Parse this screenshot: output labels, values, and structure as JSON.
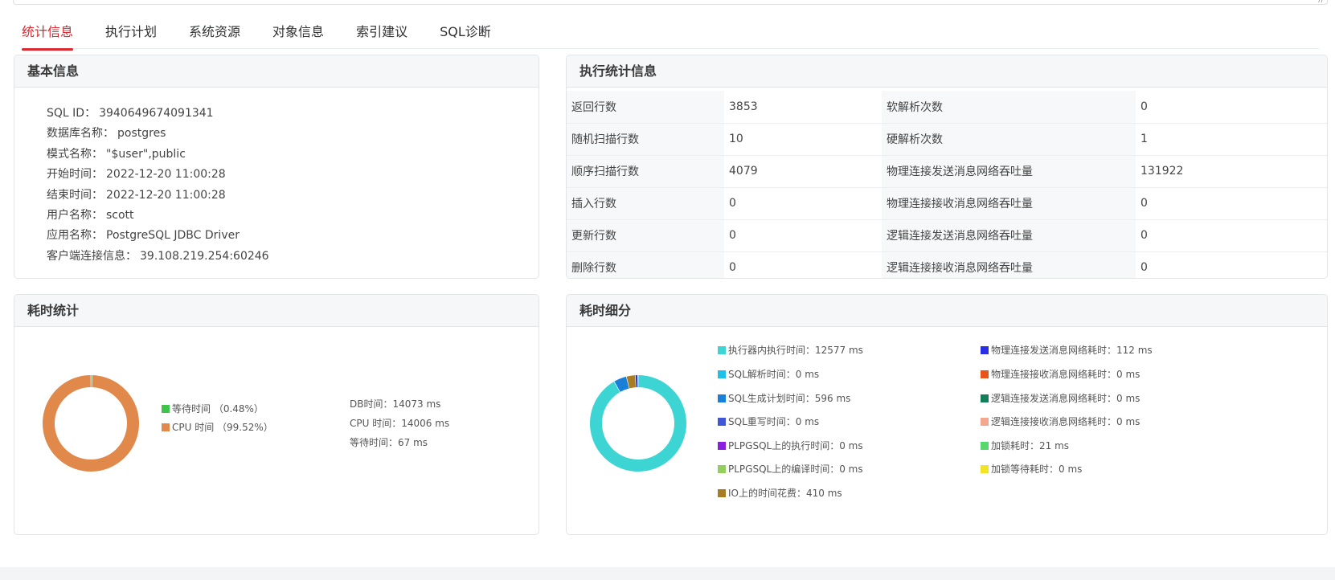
{
  "tabs": [
    "统计信息",
    "执行计划",
    "系统资源",
    "对象信息",
    "索引建议",
    "SQL诊断"
  ],
  "basic": {
    "title": "基本信息",
    "rows": [
      {
        "label": "SQL ID：",
        "value": "3940649674091341"
      },
      {
        "label": "数据库名称：",
        "value": "postgres"
      },
      {
        "label": "模式名称：",
        "value": "\"$user\",public"
      },
      {
        "label": "开始时间：",
        "value": "2022-12-20 11:00:28"
      },
      {
        "label": "结束时间：",
        "value": "2022-12-20 11:00:28"
      },
      {
        "label": "用户名称：",
        "value": "scott"
      },
      {
        "label": "应用名称：",
        "value": "PostgreSQL JDBC Driver"
      },
      {
        "label": "客户端连接信息：",
        "value": "39.108.219.254:60246"
      }
    ]
  },
  "exec": {
    "title": "执行统计信息",
    "rows": [
      [
        "返回行数",
        "3853",
        "软解析次数",
        "0"
      ],
      [
        "随机扫描行数",
        "10",
        "硬解析次数",
        "1"
      ],
      [
        "顺序扫描行数",
        "4079",
        "物理连接发送消息网络吞吐量",
        "131922"
      ],
      [
        "插入行数",
        "0",
        "物理连接接收消息网络吞吐量",
        "0"
      ],
      [
        "更新行数",
        "0",
        "逻辑连接发送消息网络吞吐量",
        "0"
      ],
      [
        "删除行数",
        "0",
        "逻辑连接接收消息网络吞吐量",
        "0"
      ]
    ]
  },
  "time_stats": {
    "title": "耗时统计",
    "legend": [
      "等待时间 （0.48%）",
      "CPU 时间 （99.52%）"
    ],
    "totals": [
      "DB时间：14073 ms",
      "CPU 时间：14006 ms",
      "等待时间：67 ms"
    ]
  },
  "time_detail": {
    "title": "耗时细分",
    "legend_left": [
      "执行器内执行时间：12577 ms",
      "SQL解析时间：0 ms",
      "SQL生成计划时间：596 ms",
      "SQL重写时间：0 ms",
      "PLPGSQL上的执行时间：0 ms",
      "PLPGSQL上的编译时间：0 ms",
      "IO上的时间花费：410 ms"
    ],
    "legend_right": [
      "物理连接发送消息网络耗时：112 ms",
      "物理连接接收消息网络耗时：0 ms",
      "逻辑连接发送消息网络耗时：0 ms",
      "逻辑连接接收消息网络耗时：0 ms",
      "加锁耗时：21 ms",
      "加锁等待耗时：0 ms"
    ]
  },
  "chart_data": [
    {
      "type": "pie",
      "labels": [
        "等待时间",
        "CPU 时间"
      ],
      "values": [
        67,
        14006
      ],
      "colors": [
        "#3fc34a",
        "#e0894b"
      ]
    },
    {
      "type": "pie",
      "labels": [
        "执行器内执行时间",
        "SQL解析时间",
        "SQL生成计划时间",
        "SQL重写时间",
        "PLPGSQL上的执行时间",
        "PLPGSQL上的编译时间",
        "IO上的时间花费",
        "物理连接发送消息网络耗时",
        "物理连接接收消息网络耗时",
        "逻辑连接发送消息网络耗时",
        "逻辑连接接收消息网络耗时",
        "加锁耗时",
        "加锁等待耗时"
      ],
      "values": [
        12577,
        0,
        596,
        0,
        0,
        0,
        410,
        112,
        0,
        0,
        0,
        21,
        0
      ],
      "colors": [
        "#3dd5d3",
        "#1ec0e8",
        "#1a7fd9",
        "#3f57d6",
        "#8a1fe0",
        "#94cf5e",
        "#a87c23",
        "#2b2de6",
        "#e8541a",
        "#147d59",
        "#f4a78f",
        "#57d86c",
        "#f3e325"
      ]
    }
  ]
}
